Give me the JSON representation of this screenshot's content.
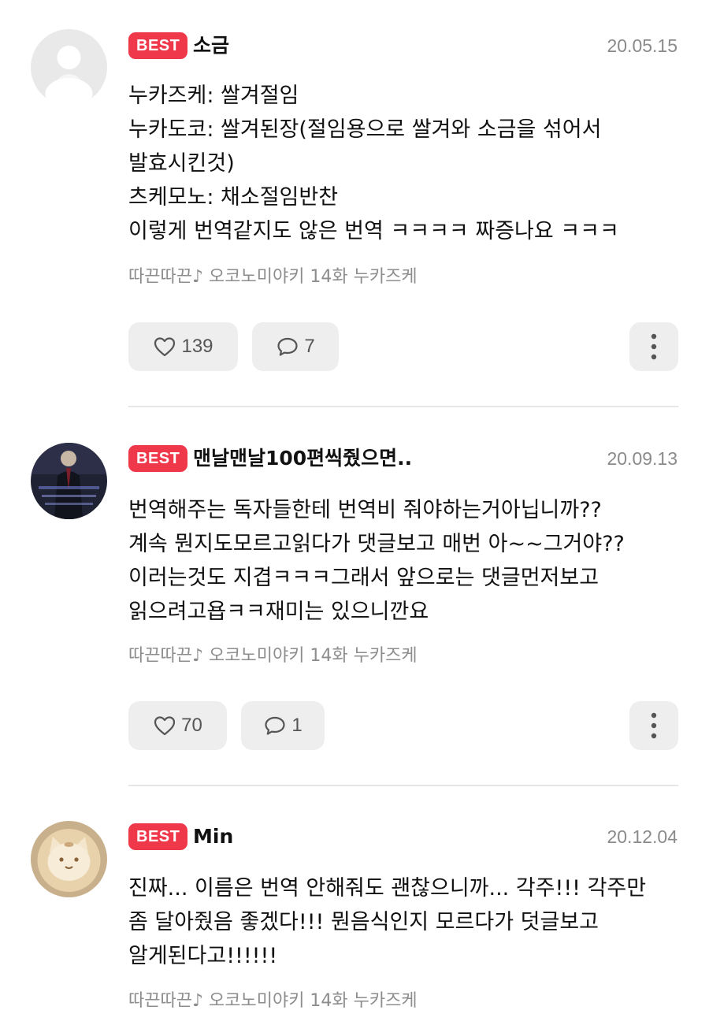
{
  "badge_label": "BEST",
  "colors": {
    "badge": "#f0384b",
    "button_bg": "#eeeeee",
    "muted_text": "#8a8a8a"
  },
  "comments": [
    {
      "nickname": "소금",
      "date": "20.05.15",
      "avatar": "default-user-avatar",
      "lines": [
        "누카즈케: 쌀겨절임",
        "누카도코: 쌀겨된장(절임용으로 쌀겨와 소금을 섞어서",
        "발효시킨것)",
        "츠케모노: 채소절임반찬",
        "이렇게 번역같지도 않은 번역 ㅋㅋㅋㅋ 짜증나요 ㅋㅋㅋ"
      ],
      "source": "따끈따끈♪ 오코노미야키 14화 누카즈케",
      "likes": "139",
      "replies": "7"
    },
    {
      "nickname": "맨날맨날100편씩줬으면..",
      "date": "20.09.13",
      "avatar": "webtoon-character-avatar",
      "lines": [
        "번역해주는 독자들한테 번역비 줘야하는거아닙니까??",
        "계속 뭔지도모르고읽다가 댓글보고 매번 아~~그거야??",
        "이러는것도 지겹ㅋㅋㅋ그래서 앞으로는 댓글먼저보고",
        "읽으려고욥ㅋㅋ재미는 있으니깐요"
      ],
      "source": "따끈따끈♪ 오코노미야키 14화 누카즈케",
      "likes": "70",
      "replies": "1"
    },
    {
      "nickname": "Min",
      "date": "20.12.04",
      "avatar": "cat-latte-art-avatar",
      "lines": [
        "진짜... 이름은 번역 안해줘도 괜찮으니까... 각주!!! 각주만",
        "좀 달아줬음 좋겠다!!! 뭔음식인지 모르다가 덧글보고",
        "알게된다고!!!!!!"
      ],
      "source": "따끈따끈♪ 오코노미야키 14화 누카즈케"
    }
  ]
}
